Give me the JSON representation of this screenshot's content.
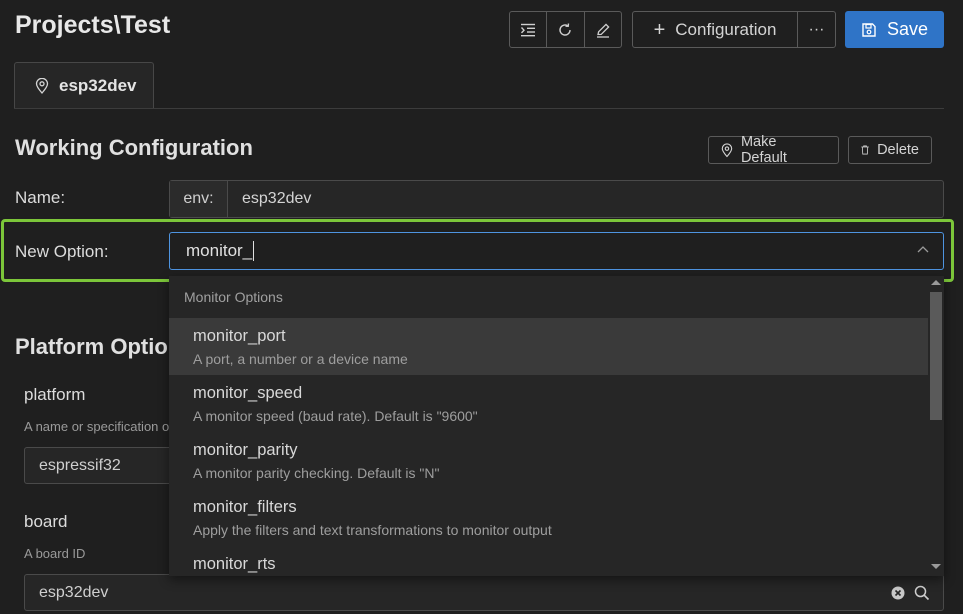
{
  "header": {
    "title": "Projects\\Test",
    "configuration_label": "Configuration",
    "more_label": "···",
    "save_label": "Save"
  },
  "tabs": [
    {
      "label": "esp32dev",
      "icon": "location-pin-icon"
    }
  ],
  "working": {
    "title": "Working Configuration",
    "make_default_label": "Make Default",
    "delete_label": "Delete",
    "name_label": "Name:",
    "name_prefix": "env:",
    "name_value": "esp32dev",
    "new_option_label": "New Option:",
    "new_option_value": "monitor_"
  },
  "platform": {
    "title": "Platform Options",
    "fields": [
      {
        "name": "platform",
        "help": "A name or specification of development platform",
        "value": "espressif32"
      },
      {
        "name": "board",
        "help": "A board ID",
        "value": "esp32dev"
      }
    ]
  },
  "dropdown": {
    "group_label": "Monitor Options",
    "items": [
      {
        "name": "monitor_port",
        "desc": "A port, a number or a device name"
      },
      {
        "name": "monitor_speed",
        "desc": "A monitor speed (baud rate). Default is \"9600\""
      },
      {
        "name": "monitor_parity",
        "desc": "A monitor parity checking. Default is \"N\""
      },
      {
        "name": "monitor_filters",
        "desc": "Apply the filters and text transformations to monitor output"
      },
      {
        "name": "monitor_rts",
        "desc": ""
      }
    ]
  },
  "colors": {
    "accent": "#2f74c7",
    "highlight": "#7cc63a",
    "focus_border": "#4e94e0",
    "background": "#1f1f1f"
  }
}
